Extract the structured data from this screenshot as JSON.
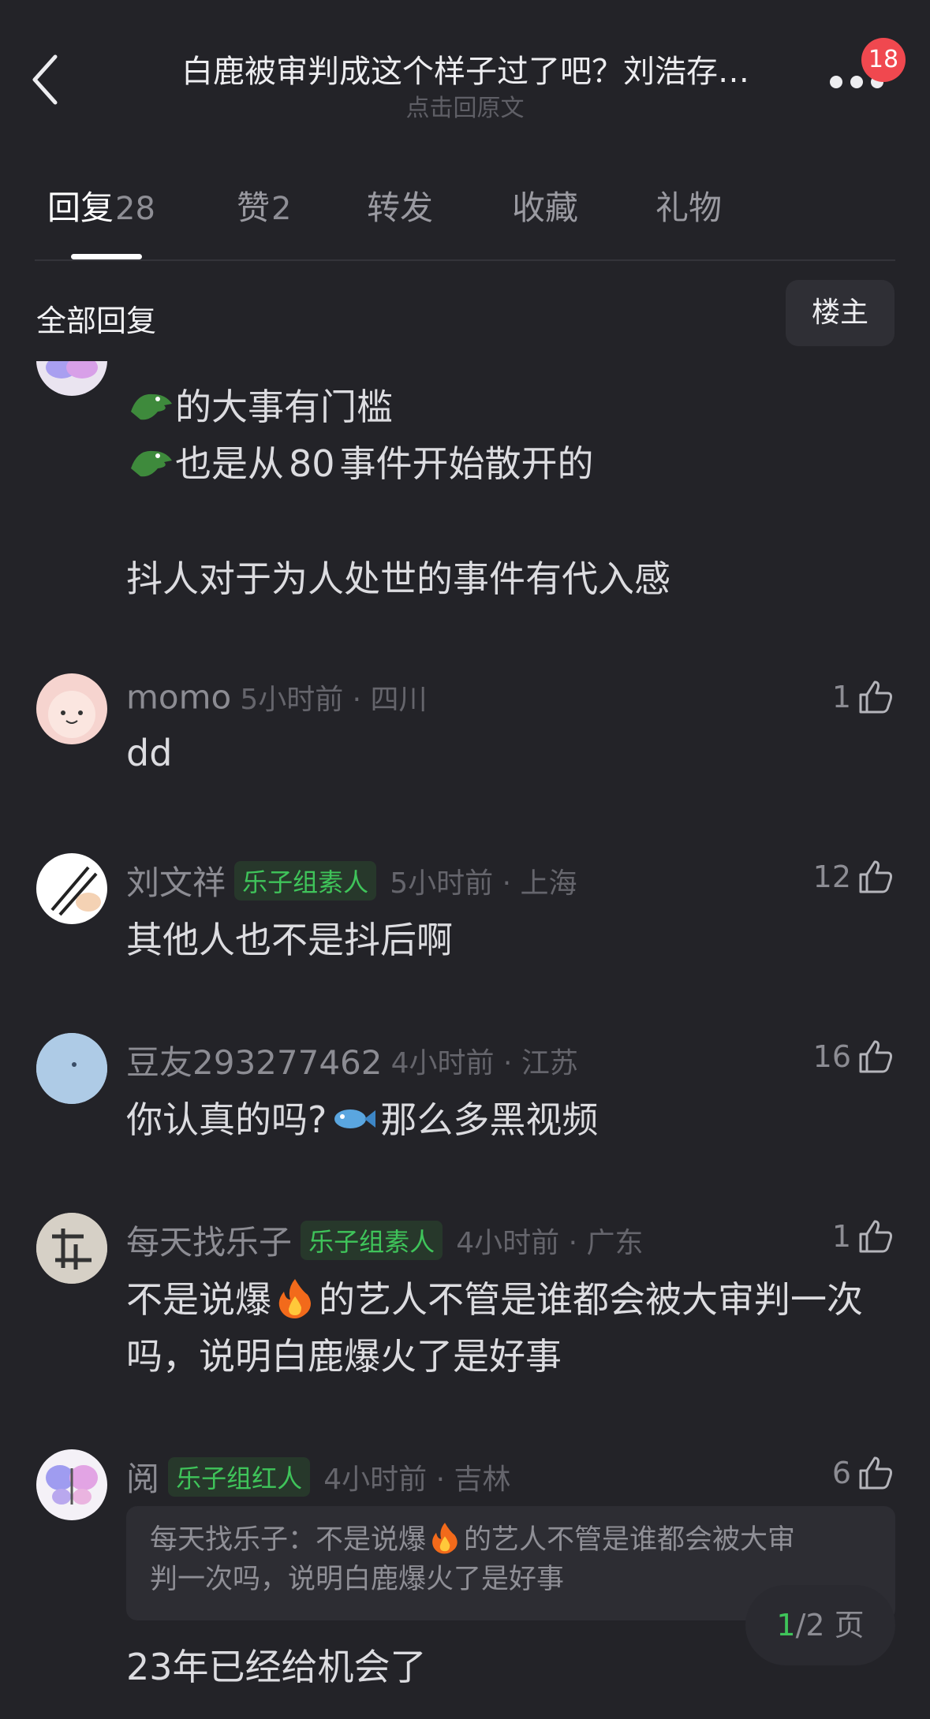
{
  "header": {
    "title": "白鹿被审判成这个样子过了吧？刘浩存…",
    "subtitle": "点击回原文",
    "notification_count": "18"
  },
  "tabs": [
    {
      "label": "回复",
      "count": "28",
      "active": true
    },
    {
      "label": "赞",
      "count": "2",
      "active": false
    },
    {
      "label": "转发",
      "count": "",
      "active": false
    },
    {
      "label": "收藏",
      "count": "",
      "active": false
    },
    {
      "label": "礼物",
      "count": "",
      "active": false
    }
  ],
  "section": {
    "title": "全部回复",
    "owner_button": "楼主"
  },
  "first_comment": {
    "line1": "的大事有门槛",
    "line2_a": "也是从",
    "line2_b": "80",
    "line2_c": "事件开始散开的",
    "line3": "抖人对于为人处世的事件有代入感",
    "emoji": "crocodile-emoji"
  },
  "comments": [
    {
      "name": "momo",
      "tag": "",
      "time": "5小时前 · 四川",
      "likes": "1",
      "lines": [
        "dd"
      ]
    },
    {
      "name": "刘文祥",
      "tag": "乐子组素人",
      "time": "5小时前 · 上海",
      "likes": "12",
      "lines": [
        "其他人也不是抖后啊"
      ]
    },
    {
      "name": "豆友293277462",
      "tag": "",
      "time": "4小时前 · 江苏",
      "likes": "16",
      "text_a": "你认真的吗?",
      "text_b": "那么多黑视频"
    },
    {
      "name": "每天找乐子",
      "tag": "乐子组素人",
      "time": "4小时前 · 广东",
      "likes": "1",
      "text_a": "不是说爆",
      "text_b": "的艺人不管是谁都会被大审判一次",
      "line2": "吗，说明白鹿爆火了是好事"
    },
    {
      "name": "阅",
      "tag": "乐子组红人",
      "time": "4小时前 · 吉林",
      "likes": "6",
      "quote_a": "每天找乐子：不是说爆",
      "quote_b": "的艺人不管是谁都会被大审",
      "quote_line2": "判一次吗，说明白鹿爆火了是好事",
      "text": "23年已经给机会了"
    }
  ],
  "pager": {
    "current": "1",
    "total_text": "/2 页"
  },
  "colors": {
    "background": "#232328",
    "tag_green": "#3fc45a",
    "badge_red": "#f0484f"
  }
}
